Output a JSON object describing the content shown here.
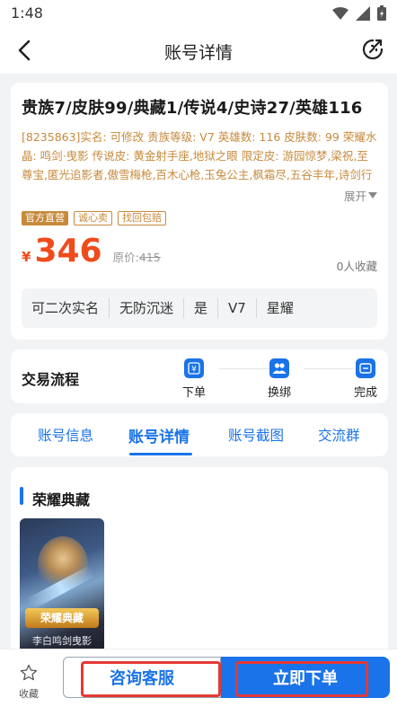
{
  "status_bar": {
    "time": "1:48"
  },
  "nav": {
    "title": "账号详情"
  },
  "account": {
    "title": "贵族7/皮肤99/典藏1/传说4/史诗27/英雄116",
    "description": "[8235863]实名: 可修改 贵族等级: V7 英雄数: 116 皮肤数: 99 荣耀水晶: 鸣剑·曳影 传说皮: 黄金射手座,地狱之眼 限定皮: 游园惊梦,梁祝,至尊宝,匿光追影者,傲雪梅枪,百木心枪,玉兔公主,枫霜尽,五谷丰年,诗剑行",
    "expand_label": "展开",
    "tags": [
      "官方直营",
      "诚心卖",
      "找回包赔"
    ],
    "price_currency": "¥",
    "price": "346",
    "original_price_label": "原价:",
    "original_price": "415",
    "favorites": "0人收藏",
    "attributes": [
      "可二次实名",
      "无防沉迷",
      "是",
      "V7",
      "星耀"
    ]
  },
  "flow": {
    "title": "交易流程",
    "steps": [
      "下单",
      "换绑",
      "完成"
    ]
  },
  "tabs": [
    "账号信息",
    "账号详情",
    "账号截图",
    "交流群"
  ],
  "active_tab": "账号详情",
  "section": {
    "title": "荣耀典藏",
    "skin_badge": "荣耀典藏",
    "skin_name": "李白鸣剑曳影"
  },
  "bottom": {
    "collect_label": "收藏",
    "consult_label": "咨询客服",
    "order_label": "立即下单"
  },
  "colors": {
    "accent": "#1a73e8",
    "price": "#f04b1c",
    "gold": "#c78a3c",
    "highlight": "#e53935"
  }
}
